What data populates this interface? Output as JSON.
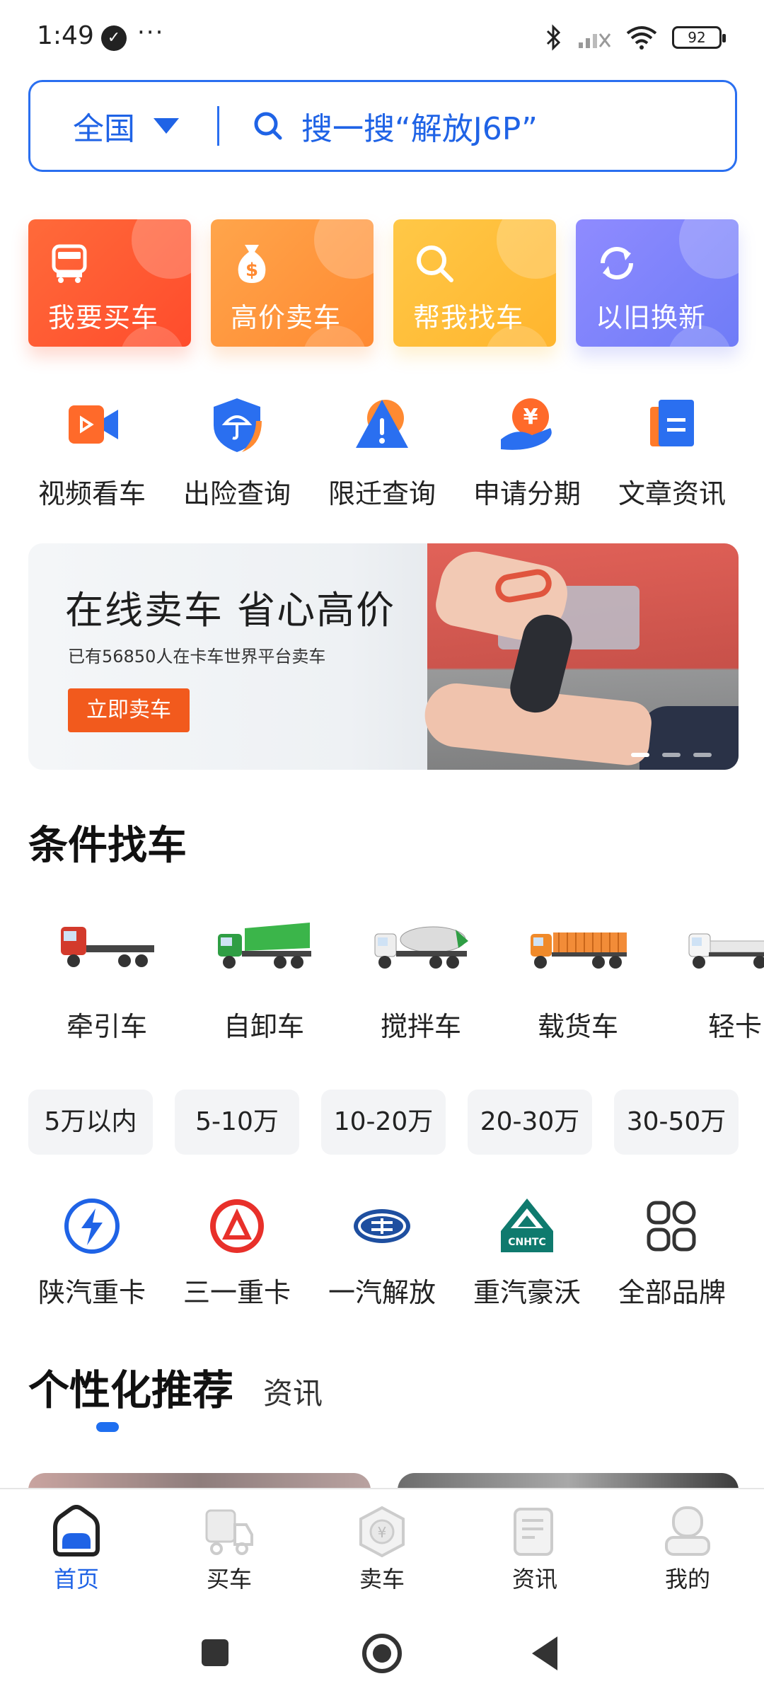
{
  "status_bar": {
    "time": "1:49",
    "dots": "···",
    "battery": "92"
  },
  "search": {
    "region": "全国",
    "placeholder": "搜一搜“解放J6P”"
  },
  "quick_actions": [
    {
      "label": "我要买车",
      "icon": "truck-front-icon"
    },
    {
      "label": "高价卖车",
      "icon": "money-bag-icon"
    },
    {
      "label": "帮我找车",
      "icon": "search-icon"
    },
    {
      "label": "以旧换新",
      "icon": "refresh-icon"
    }
  ],
  "features": [
    {
      "label": "视频看车",
      "icon": "video-icon"
    },
    {
      "label": "出险查询",
      "icon": "shield-umbrella-icon"
    },
    {
      "label": "限迁查询",
      "icon": "warning-icon"
    },
    {
      "label": "申请分期",
      "icon": "yuan-installment-icon"
    },
    {
      "label": "文章资讯",
      "icon": "article-icon"
    }
  ],
  "banner": {
    "title": "在线卖车 省心高价",
    "subtitle": "已有56850人在卡车世界平台卖车",
    "button": "立即卖车"
  },
  "section_conditions": {
    "title": "条件找车"
  },
  "truck_types": [
    {
      "label": "牵引车",
      "icon": "tractor-truck-icon"
    },
    {
      "label": "自卸车",
      "icon": "dump-truck-icon"
    },
    {
      "label": "搅拌车",
      "icon": "mixer-truck-icon"
    },
    {
      "label": "载货车",
      "icon": "cargo-truck-icon"
    },
    {
      "label": "轻卡",
      "icon": "light-truck-icon"
    }
  ],
  "price_ranges": [
    "5万以内",
    "5-10万",
    "10-20万",
    "20-30万",
    "30-50万"
  ],
  "brands": [
    {
      "label": "陕汽重卡",
      "icon": "shacman-logo-icon"
    },
    {
      "label": "三一重卡",
      "icon": "sany-logo-icon"
    },
    {
      "label": "一汽解放",
      "icon": "faw-logo-icon"
    },
    {
      "label": "重汽豪沃",
      "icon": "cnhtc-logo-icon"
    },
    {
      "label": "全部品牌",
      "icon": "grid-icon"
    }
  ],
  "recommend": {
    "title": "个性化推荐",
    "tab": "资讯"
  },
  "bottom_nav": [
    {
      "label": "首页",
      "icon": "home-icon",
      "active": true
    },
    {
      "label": "买车",
      "icon": "truck-icon"
    },
    {
      "label": "卖车",
      "icon": "yuan-hexagon-icon"
    },
    {
      "label": "资讯",
      "icon": "document-icon"
    },
    {
      "label": "我的",
      "icon": "user-icon"
    }
  ],
  "colors": {
    "accent": "#1f63e6",
    "sell_button": "#f25a1d"
  }
}
